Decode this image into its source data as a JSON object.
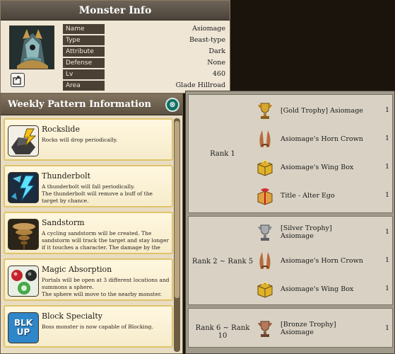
{
  "monster_info": {
    "title": "Monster Info",
    "rows": [
      {
        "label": "Name",
        "value": "Asiomage"
      },
      {
        "label": "Type",
        "value": "Beast-type"
      },
      {
        "label": "Attribute",
        "value": "Dark"
      },
      {
        "label": "Defense type",
        "value": "None"
      },
      {
        "label": "Lv",
        "value": "460"
      },
      {
        "label": "Area",
        "value": "Glade Hillroad"
      }
    ]
  },
  "weekly": {
    "title": "Weekly Pattern Information",
    "close_icon": "⊗",
    "patterns": [
      {
        "name": "Rockslide",
        "icon": "rockslide-icon",
        "desc": "Rocks will drop periodically."
      },
      {
        "name": "Thunderbolt",
        "icon": "thunderbolt-icon",
        "desc": "A thunderbolt will fall periodically.\nThe thunderbolt will remove a buff of the target by chance."
      },
      {
        "name": "Sandstorm",
        "icon": "sandstorm-icon",
        "desc": "A cycling sandstorm will be created. The sandstorm will track the target and stay longer if it touches a character. The damage by the"
      },
      {
        "name": "Magic Absorption",
        "icon": "magic-absorption-icon",
        "desc": "Portals will be open at 3 different locations and summons a sphere.\nThe sphere will move to the nearby monster."
      },
      {
        "name": "Block Specialty",
        "icon": "block-specialty-icon",
        "icon_text": "BLK UP",
        "desc": "Boss monster is now capable of Blocking."
      }
    ]
  },
  "rewards": {
    "groups": [
      {
        "rank": "Rank 1",
        "items": [
          {
            "name": "[Gold Trophy] Asiomage",
            "qty": "1",
            "icon": "gold-trophy-icon"
          },
          {
            "name": "Asiomage's Horn Crown",
            "qty": "1",
            "icon": "horn-crown-icon"
          },
          {
            "name": "Asiomage's Wing Box",
            "qty": "1",
            "icon": "wing-box-icon"
          },
          {
            "name": "Title - Alter Ego",
            "qty": "1",
            "icon": "title-box-icon"
          }
        ]
      },
      {
        "rank": "Rank 2 ~ Rank 5",
        "items": [
          {
            "name": "[Silver Trophy]\nAsiomage",
            "qty": "1",
            "icon": "silver-trophy-icon"
          },
          {
            "name": "Asiomage's Horn Crown",
            "qty": "1",
            "icon": "horn-crown-icon"
          },
          {
            "name": "Asiomage's Wing Box",
            "qty": "1",
            "icon": "wing-box-icon"
          }
        ]
      },
      {
        "rank": "Rank 6 ~ Rank 10",
        "items": [
          {
            "name": "[Bronze Trophy]\nAsiomage",
            "qty": "1",
            "icon": "bronze-trophy-icon"
          }
        ]
      }
    ]
  },
  "colors": {
    "gold": "#d8a630",
    "silver": "#a8acb0",
    "bronze": "#b47a5a",
    "teal_close": "#0f6f64"
  }
}
